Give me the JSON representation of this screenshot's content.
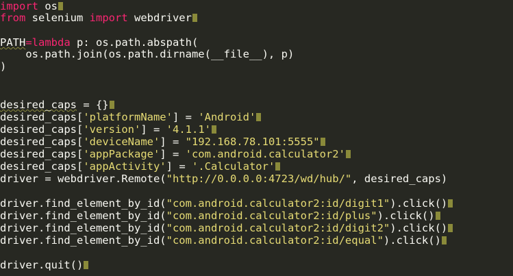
{
  "editor": {
    "lines": [
      {
        "tokens": [
          {
            "t": "import",
            "c": "kw"
          },
          {
            "t": " os",
            "c": "plain"
          }
        ],
        "marker": true
      },
      {
        "tokens": [
          {
            "t": "from",
            "c": "kw"
          },
          {
            "t": " selenium ",
            "c": "plain"
          },
          {
            "t": "import",
            "c": "kw"
          },
          {
            "t": " webdriver",
            "c": "plain"
          }
        ],
        "marker": true
      },
      {
        "tokens": [],
        "marker": false
      },
      {
        "tokens": [
          {
            "t": "PATH",
            "c": "squiggle"
          },
          {
            "t": "=",
            "c": "kw"
          },
          {
            "t": "lambda",
            "c": "kw"
          },
          {
            "t": " p: os.path.abspath(",
            "c": "plain"
          }
        ],
        "marker": false
      },
      {
        "tokens": [
          {
            "t": "    os.path.join(os.path.dirname(__file__),",
            "c": "plain"
          },
          {
            "t": " ",
            "c": "plain"
          },
          {
            "t": "p)",
            "c": "plain"
          }
        ],
        "marker": false
      },
      {
        "tokens": [
          {
            "t": ")",
            "c": "plain"
          }
        ],
        "marker": false
      },
      {
        "tokens": [],
        "marker": false
      },
      {
        "tokens": [],
        "marker": false
      },
      {
        "tokens": [
          {
            "t": "desired_caps",
            "c": "squiggle"
          },
          {
            "t": " = {}",
            "c": "plain"
          }
        ],
        "marker": true
      },
      {
        "tokens": [
          {
            "t": "desired_caps[",
            "c": "plain"
          },
          {
            "t": "'platformName'",
            "c": "str"
          },
          {
            "t": "] = ",
            "c": "plain"
          },
          {
            "t": "'Android'",
            "c": "str"
          }
        ],
        "marker": true
      },
      {
        "tokens": [
          {
            "t": "desired_caps[",
            "c": "plain"
          },
          {
            "t": "'version'",
            "c": "str"
          },
          {
            "t": "] = ",
            "c": "plain"
          },
          {
            "t": "'4.1.1'",
            "c": "str"
          }
        ],
        "marker": true
      },
      {
        "tokens": [
          {
            "t": "desired_caps[",
            "c": "plain"
          },
          {
            "t": "'deviceName'",
            "c": "str"
          },
          {
            "t": "] = ",
            "c": "plain"
          },
          {
            "t": "\"192.168.78.101:5555\"",
            "c": "str"
          }
        ],
        "marker": true
      },
      {
        "tokens": [
          {
            "t": "desired_caps[",
            "c": "plain"
          },
          {
            "t": "'appPackage'",
            "c": "str"
          },
          {
            "t": "] = ",
            "c": "plain"
          },
          {
            "t": "'com.android.calculator2'",
            "c": "str"
          }
        ],
        "marker": true
      },
      {
        "tokens": [
          {
            "t": "desired_caps[",
            "c": "plain"
          },
          {
            "t": "'appActivity'",
            "c": "str"
          },
          {
            "t": "] = ",
            "c": "plain"
          },
          {
            "t": "'.Calculator'",
            "c": "str"
          }
        ],
        "marker": true
      },
      {
        "tokens": [
          {
            "t": "driver = webdriver.Remote(",
            "c": "plain"
          },
          {
            "t": "\"http://0.0.0.0:4723/wd/hub/\"",
            "c": "str"
          },
          {
            "t": ", desired_caps)",
            "c": "plain"
          }
        ],
        "marker": false
      },
      {
        "tokens": [],
        "marker": false
      },
      {
        "tokens": [
          {
            "t": "driver.find_element_by_id(",
            "c": "plain"
          },
          {
            "t": "\"com.android.calculator2:id/digit1\"",
            "c": "str"
          },
          {
            "t": ").click()",
            "c": "plain"
          }
        ],
        "marker": true
      },
      {
        "tokens": [
          {
            "t": "driver.find_element_by_id(",
            "c": "plain"
          },
          {
            "t": "\"com.android.calculator2:id/plus\"",
            "c": "str"
          },
          {
            "t": ").click()",
            "c": "plain"
          }
        ],
        "marker": true
      },
      {
        "tokens": [
          {
            "t": "driver.find_element_by_id(",
            "c": "plain"
          },
          {
            "t": "\"com.android.calculator2:id/digit2\"",
            "c": "str"
          },
          {
            "t": ").click()",
            "c": "plain"
          }
        ],
        "marker": true
      },
      {
        "tokens": [
          {
            "t": "driver.find_element_by_id(",
            "c": "plain"
          },
          {
            "t": "\"com.android.calculator2:id/equal\"",
            "c": "str"
          },
          {
            "t": ").click()",
            "c": "plain"
          }
        ],
        "marker": true
      },
      {
        "tokens": [],
        "marker": false
      },
      {
        "tokens": [
          {
            "t": "driver.quit()",
            "c": "plain"
          }
        ],
        "marker": true
      }
    ]
  }
}
